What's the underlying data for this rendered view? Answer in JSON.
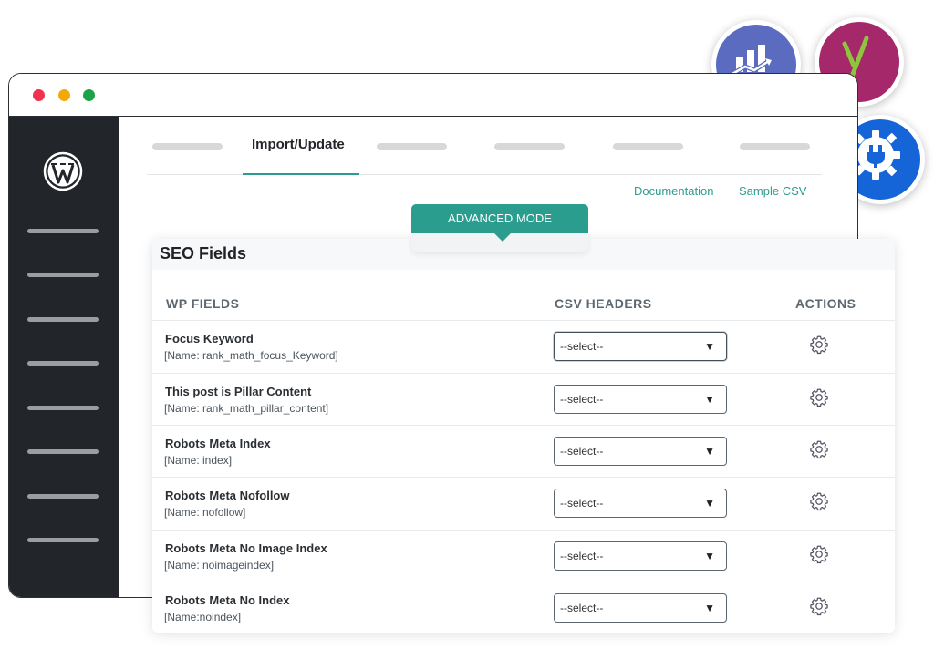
{
  "window": {
    "dots": [
      "close",
      "minimize",
      "maximize"
    ]
  },
  "tabs": {
    "active_label": "Import/Update"
  },
  "links": {
    "documentation": "Documentation",
    "sample_csv": "Sample CSV"
  },
  "advanced_mode": {
    "label": "ADVANCED MODE"
  },
  "card": {
    "title": "SEO Fields",
    "columns": {
      "wp_fields": "WP FIELDS",
      "csv_headers": "CSV HEADERS",
      "actions": "ACTIONS"
    },
    "rows": [
      {
        "label": "Focus Keyword",
        "key": "[Name: rank_math_focus_Keyword]",
        "select": "--select--"
      },
      {
        "label": "This post is Pillar Content",
        "key": "[Name: rank_math_pillar_content]",
        "select": "--select--"
      },
      {
        "label": "Robots Meta Index",
        "key": "[Name: index]",
        "select": "--select--"
      },
      {
        "label": "Robots Meta Nofollow",
        "key": "[Name: nofollow]",
        "select": "--select--"
      },
      {
        "label": "Robots Meta No Image Index",
        "key": "[Name: noimageindex]",
        "select": "--select--"
      },
      {
        "label": "Robots Meta No Index",
        "key": "[Name:noindex]",
        "select": "--select--"
      }
    ]
  },
  "colors": {
    "accent": "#2a9d8f",
    "sidebar": "#22252a",
    "chart_badge": "#5b6bbf",
    "yoast_badge": "#a4286a",
    "plugin_badge": "#1565d8"
  },
  "icons": [
    "wordpress-icon",
    "chart-growth-icon",
    "yoast-icon",
    "plugin-gear-icon",
    "gear-icon",
    "caret-down-icon"
  ]
}
